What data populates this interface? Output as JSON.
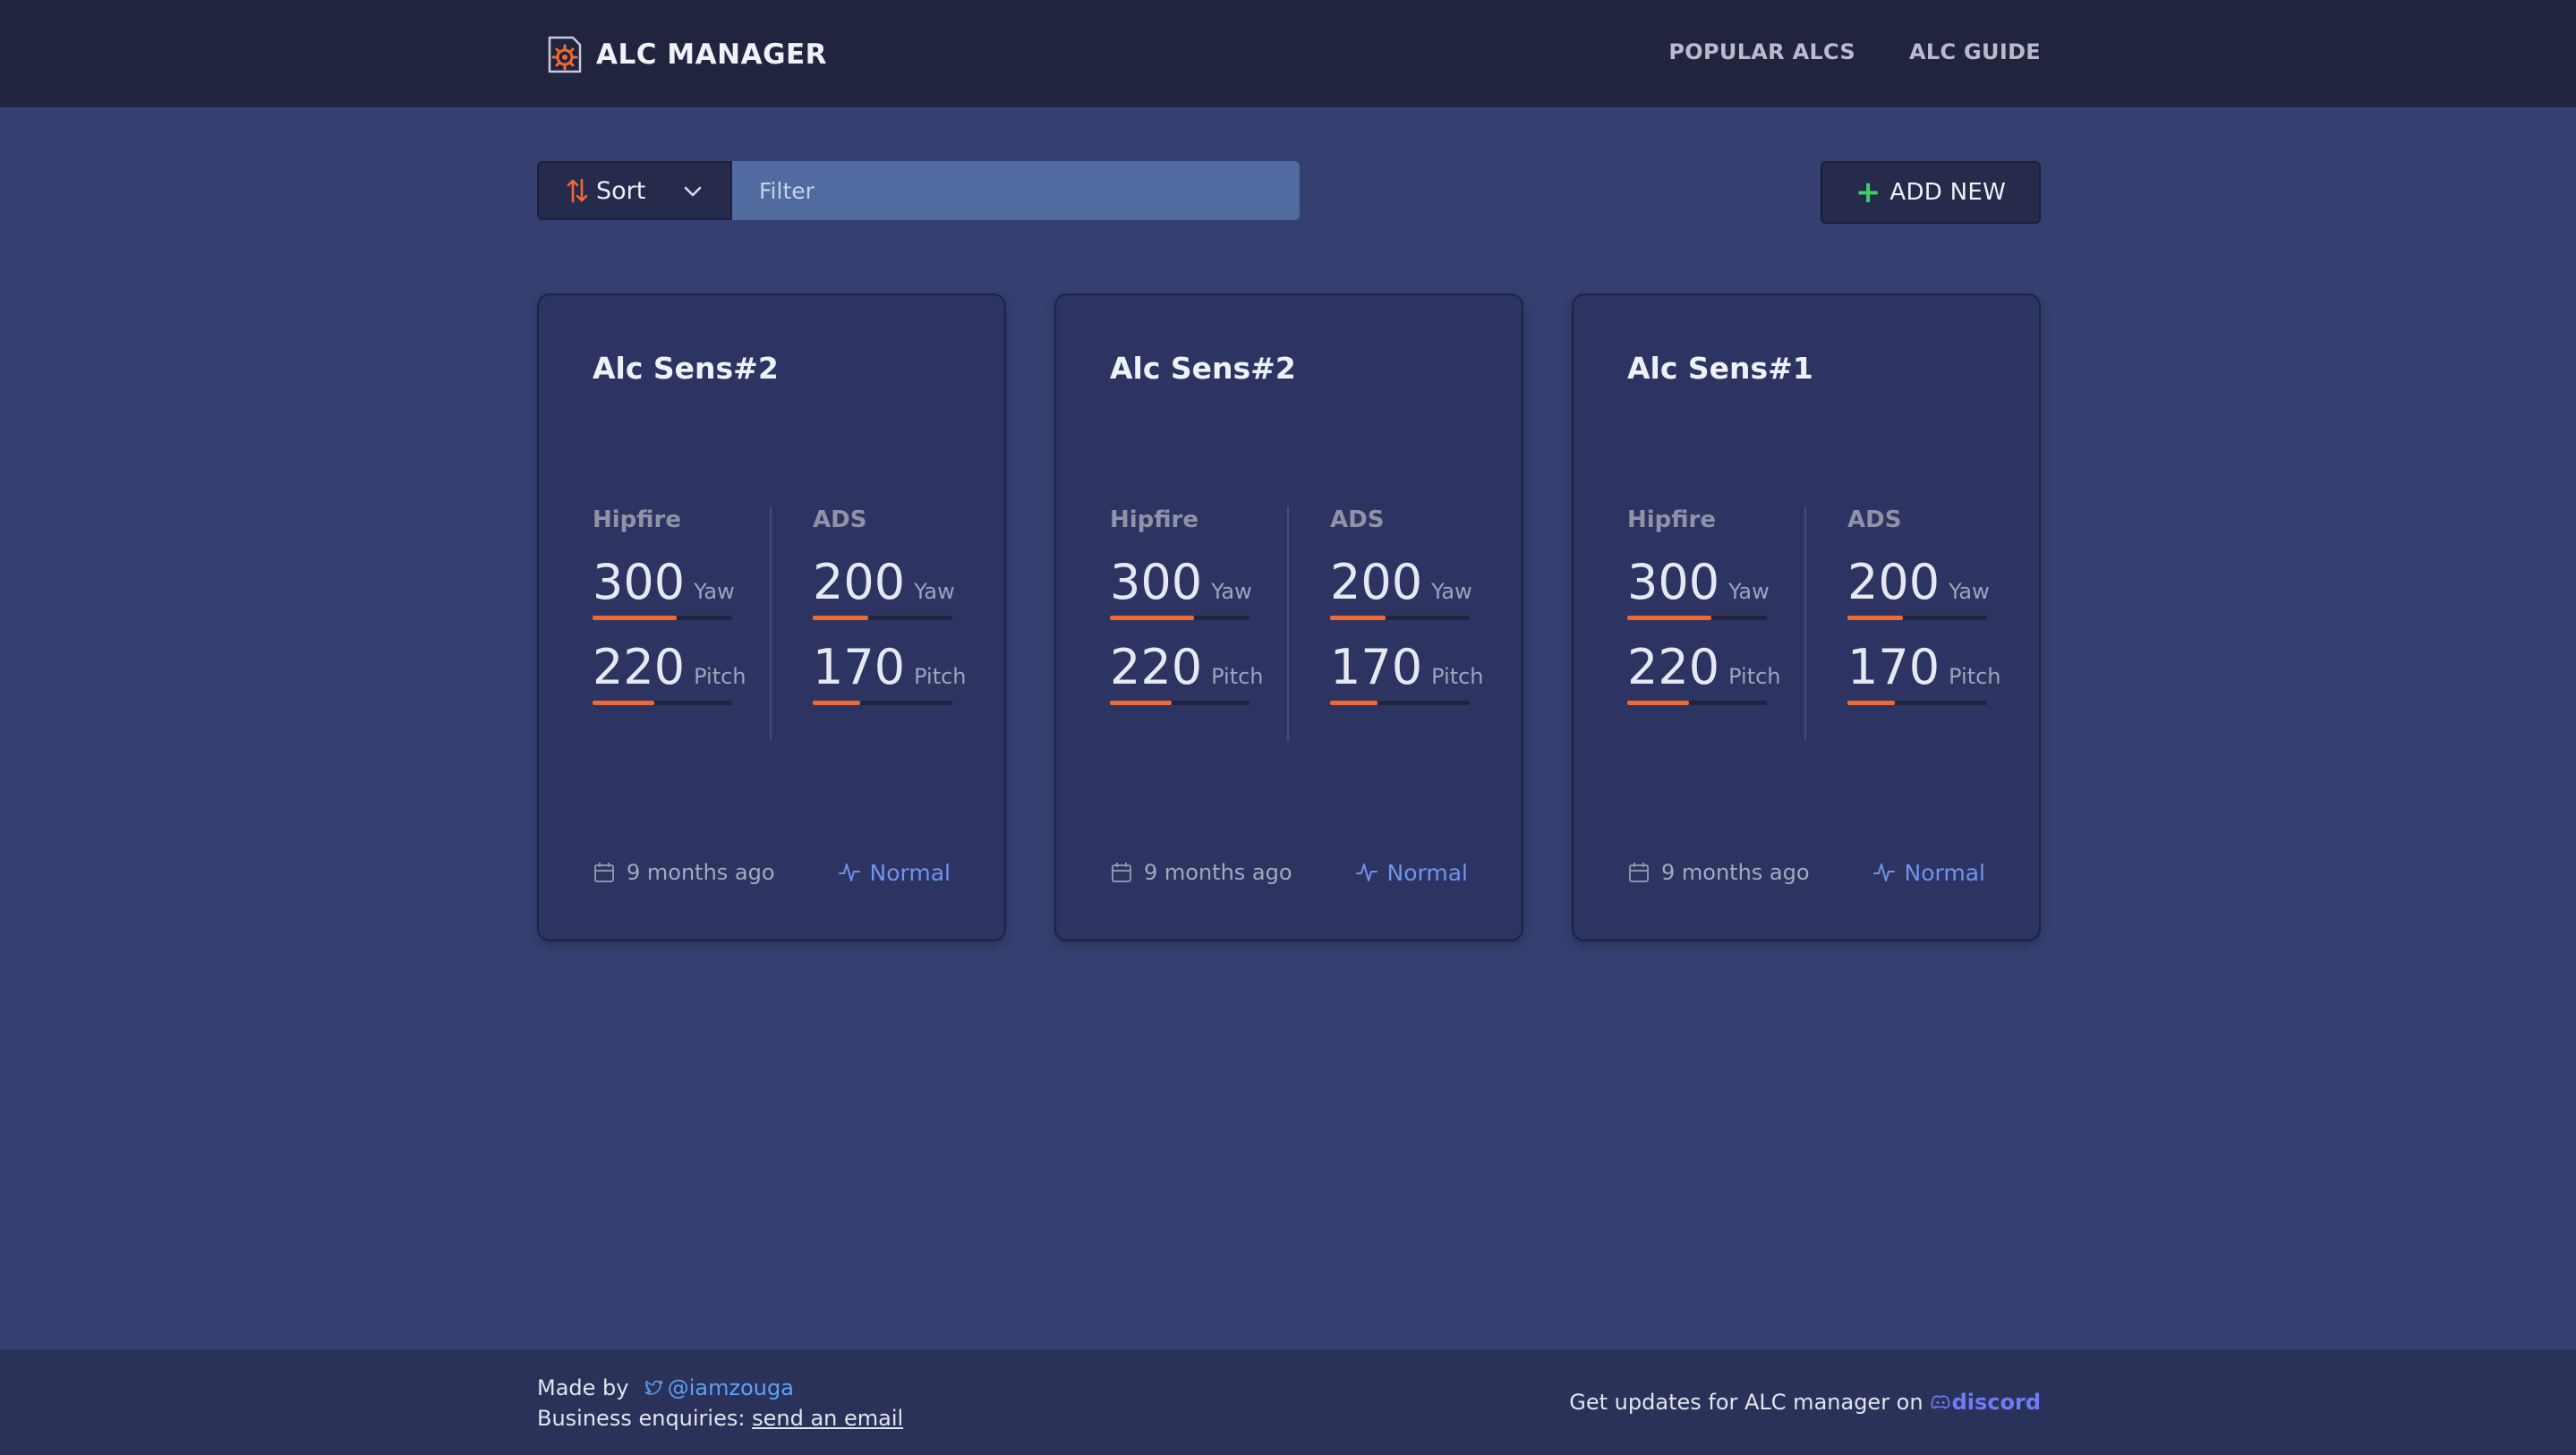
{
  "header": {
    "title": "ALC MANAGER",
    "nav": [
      "POPULAR ALCS",
      "ALC GUIDE"
    ]
  },
  "toolbar": {
    "sort_label": "Sort",
    "filter_placeholder": "Filter",
    "add_label": "ADD NEW"
  },
  "colors": {
    "accent": "#ee6a32",
    "add": "#3fcf62",
    "mode": "#6f93ec",
    "link": "#60a0f4",
    "discord": "#6f7cf2"
  },
  "cards": [
    {
      "title": "Alc Sens#2",
      "hipfire": {
        "label": "Hipfire",
        "yaw": "300",
        "yaw_unit": "Yaw",
        "pitch": "220",
        "pitch_unit": "Pitch",
        "yaw_fill": 0.6,
        "pitch_fill": 0.44
      },
      "ads": {
        "label": "ADS",
        "yaw": "200",
        "yaw_unit": "Yaw",
        "pitch": "170",
        "pitch_unit": "Pitch",
        "yaw_fill": 0.4,
        "pitch_fill": 0.34
      },
      "date": "9 months ago",
      "mode": "Normal"
    },
    {
      "title": "Alc Sens#2",
      "hipfire": {
        "label": "Hipfire",
        "yaw": "300",
        "yaw_unit": "Yaw",
        "pitch": "220",
        "pitch_unit": "Pitch",
        "yaw_fill": 0.6,
        "pitch_fill": 0.44
      },
      "ads": {
        "label": "ADS",
        "yaw": "200",
        "yaw_unit": "Yaw",
        "pitch": "170",
        "pitch_unit": "Pitch",
        "yaw_fill": 0.4,
        "pitch_fill": 0.34
      },
      "date": "9 months ago",
      "mode": "Normal"
    },
    {
      "title": "Alc Sens#1",
      "hipfire": {
        "label": "Hipfire",
        "yaw": "300",
        "yaw_unit": "Yaw",
        "pitch": "220",
        "pitch_unit": "Pitch",
        "yaw_fill": 0.6,
        "pitch_fill": 0.44
      },
      "ads": {
        "label": "ADS",
        "yaw": "200",
        "yaw_unit": "Yaw",
        "pitch": "170",
        "pitch_unit": "Pitch",
        "yaw_fill": 0.4,
        "pitch_fill": 0.34
      },
      "date": "9 months ago",
      "mode": "Normal"
    }
  ],
  "footer": {
    "made_by": "Made by",
    "twitter": "@iamzouga",
    "business": "Business enquiries:",
    "email_link": "send an email",
    "updates": "Get updates for ALC manager on",
    "discord": "discord"
  }
}
